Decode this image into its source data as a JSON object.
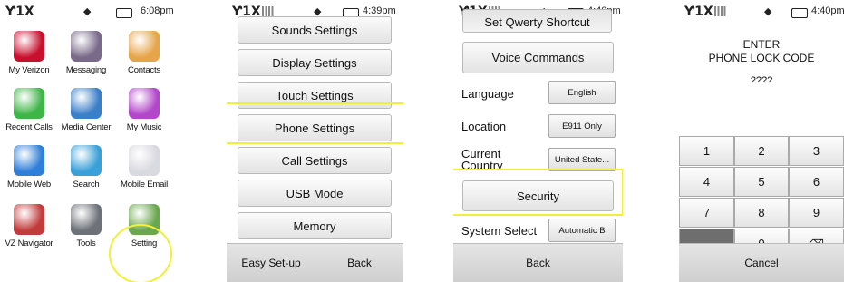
{
  "screen1": {
    "status": {
      "signal": "1X",
      "time": "6:08pm"
    },
    "apps": [
      {
        "label": "My Verizon",
        "icon": "verizon-icon",
        "color": "#c8102e"
      },
      {
        "label": "Messaging",
        "icon": "mailbox-icon",
        "color": "#7a6a8a"
      },
      {
        "label": "Contacts",
        "icon": "contacts-icon",
        "color": "#e7a54a"
      },
      {
        "label": "Recent Calls",
        "icon": "recent-calls-icon",
        "color": "#3fb548"
      },
      {
        "label": "Media Center",
        "icon": "media-center-icon",
        "color": "#3b7fc9"
      },
      {
        "label": "My Music",
        "icon": "music-icon",
        "color": "#b347c9"
      },
      {
        "label": "Mobile Web",
        "icon": "globe-icon",
        "color": "#2f7ed8"
      },
      {
        "label": "Search",
        "icon": "search-icon",
        "color": "#3aa0d8"
      },
      {
        "label": "Mobile Email",
        "icon": "email-icon",
        "color": "#d9d9e0"
      },
      {
        "label": "VZ Navigator",
        "icon": "compass-icon",
        "color": "#c23b3b"
      },
      {
        "label": "Tools",
        "icon": "tools-icon",
        "color": "#6d7178"
      },
      {
        "label": "Setting",
        "icon": "settings-icon",
        "color": "#6aa84f"
      }
    ]
  },
  "screen2": {
    "status": {
      "signal": "1X",
      "time": "4:39pm"
    },
    "items": [
      "Sounds Settings",
      "Display Settings",
      "Touch Settings",
      "Phone Settings",
      "Call Settings",
      "USB Mode",
      "Memory"
    ],
    "bottom": {
      "left": "Easy Set-up",
      "right": "Back"
    }
  },
  "screen3": {
    "status": {
      "signal": "1X",
      "time": "4:40pm"
    },
    "top_partial": "Set Qwerty Shortcut",
    "voice": "Voice Commands",
    "rows": [
      {
        "label": "Language",
        "value": "English"
      },
      {
        "label": "Location",
        "value": "E911 Only"
      },
      {
        "label": "Current Country",
        "value": "United State..."
      }
    ],
    "security": "Security",
    "system": {
      "label": "System Select",
      "value": "Automatic B"
    },
    "bottom": "Back"
  },
  "screen4": {
    "status": {
      "signal": "1X",
      "time": "4:40pm"
    },
    "line1": "ENTER",
    "line2": "PHONE LOCK CODE",
    "code": "????",
    "keys": [
      "1",
      "2",
      "3",
      "4",
      "5",
      "6",
      "7",
      "8",
      "9",
      "",
      "0",
      ""
    ],
    "cancel": "Cancel"
  }
}
